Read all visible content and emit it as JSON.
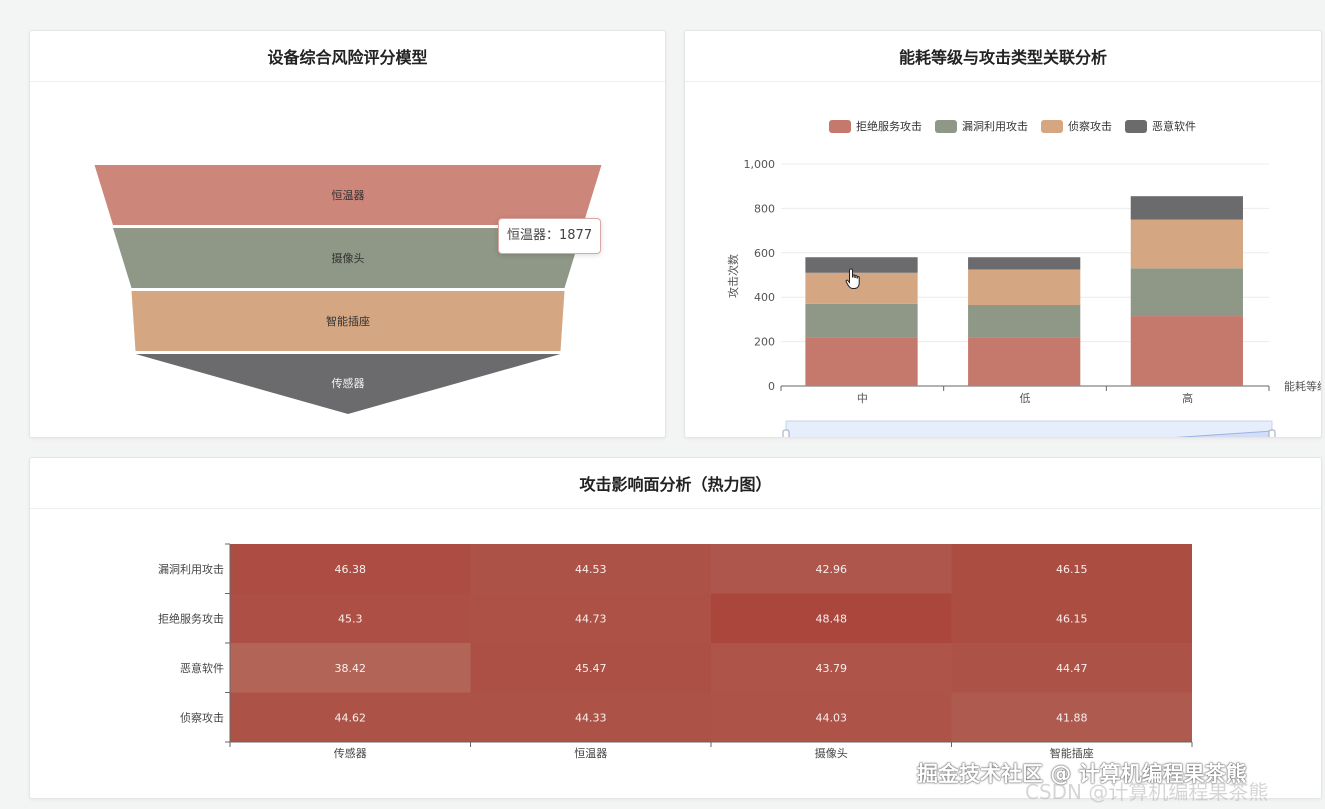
{
  "funnel_panel": {
    "title": "设备综合风险评分模型",
    "tooltip": "恒温器：1877",
    "chart_data": {
      "type": "funnel",
      "categories": [
        "恒温器",
        "摄像头",
        "智能插座",
        "传感器"
      ],
      "colors": [
        "#cc867a",
        "#8f9786",
        "#d4a682",
        "#6b6b6e"
      ]
    }
  },
  "bar_panel": {
    "title": "能耗等级与攻击类型关联分析",
    "chart_data": {
      "type": "bar",
      "stacked": true,
      "categories": [
        "中",
        "低",
        "高"
      ],
      "series": [
        {
          "name": "拒绝服务攻击",
          "color": "#c4796c",
          "values": [
            220,
            220,
            315
          ]
        },
        {
          "name": "漏洞利用攻击",
          "color": "#8f9786",
          "values": [
            150,
            145,
            215
          ]
        },
        {
          "name": "侦察攻击",
          "color": "#d4a682",
          "values": [
            140,
            160,
            220
          ]
        },
        {
          "name": "恶意软件",
          "color": "#6b6b6e",
          "values": [
            70,
            55,
            105
          ]
        }
      ],
      "ylabel": "攻击次数",
      "xlabel": "能耗等级",
      "ylim": [
        0,
        1000
      ],
      "yticks": [
        "1,000",
        "800",
        "600",
        "400",
        "200",
        "0"
      ],
      "legend": "top"
    }
  },
  "heat_panel": {
    "title": "攻击影响面分析（热力图）",
    "chart_data": {
      "type": "heatmap",
      "x": [
        "传感器",
        "恒温器",
        "摄像头",
        "智能插座"
      ],
      "y": [
        "漏洞利用攻击",
        "拒绝服务攻击",
        "恶意软件",
        "侦察攻击"
      ],
      "values": [
        [
          46.38,
          44.53,
          42.96,
          46.15
        ],
        [
          45.3,
          44.73,
          48.48,
          46.15
        ],
        [
          38.42,
          45.47,
          43.79,
          44.47
        ],
        [
          44.62,
          44.33,
          44.03,
          41.88
        ]
      ],
      "range": [
        38.42,
        48.48
      ]
    }
  },
  "watermark": {
    "text": "掘金技术社区 @ 计算机编程果茶熊",
    "text2": "CSDN @计算机编程果茶熊"
  }
}
